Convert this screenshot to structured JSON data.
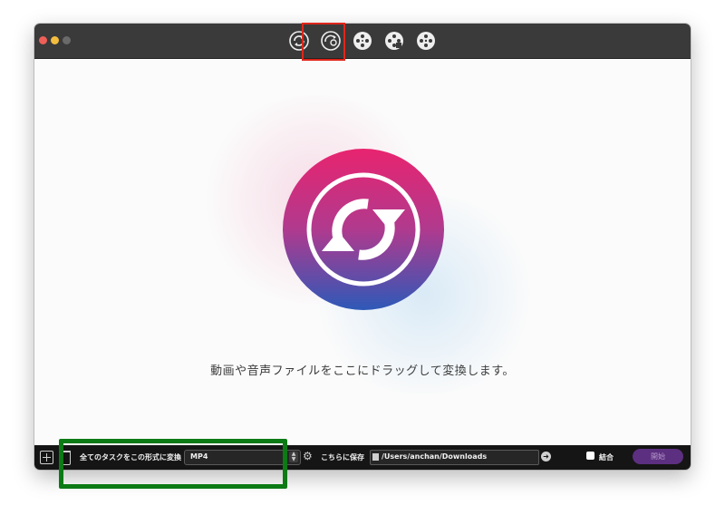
{
  "titlebar": {
    "tool_icons": [
      {
        "name": "convert-icon"
      },
      {
        "name": "dvd-convert-icon"
      },
      {
        "name": "film-reel-icon"
      },
      {
        "name": "film-reel-alt-icon"
      },
      {
        "name": "film-reel-third-icon"
      }
    ]
  },
  "main": {
    "drop_message": "動画や音声ファイルをここにドラッグして変換します。"
  },
  "bottom_bar": {
    "convert_all_label": "全てのタスクをこの形式に変換",
    "format_value": "MP4",
    "save_label": "こちらに保存",
    "save_path": "/Users/anchan/Downloads",
    "merge_label": "結合",
    "start_label": "開始"
  },
  "colors": {
    "highlight_red": "#e0261b",
    "highlight_green": "#0c7a15",
    "logo_gradient_top": "#e8246f",
    "logo_gradient_bottom": "#2e59b8",
    "start_button": "#5c2f80"
  }
}
